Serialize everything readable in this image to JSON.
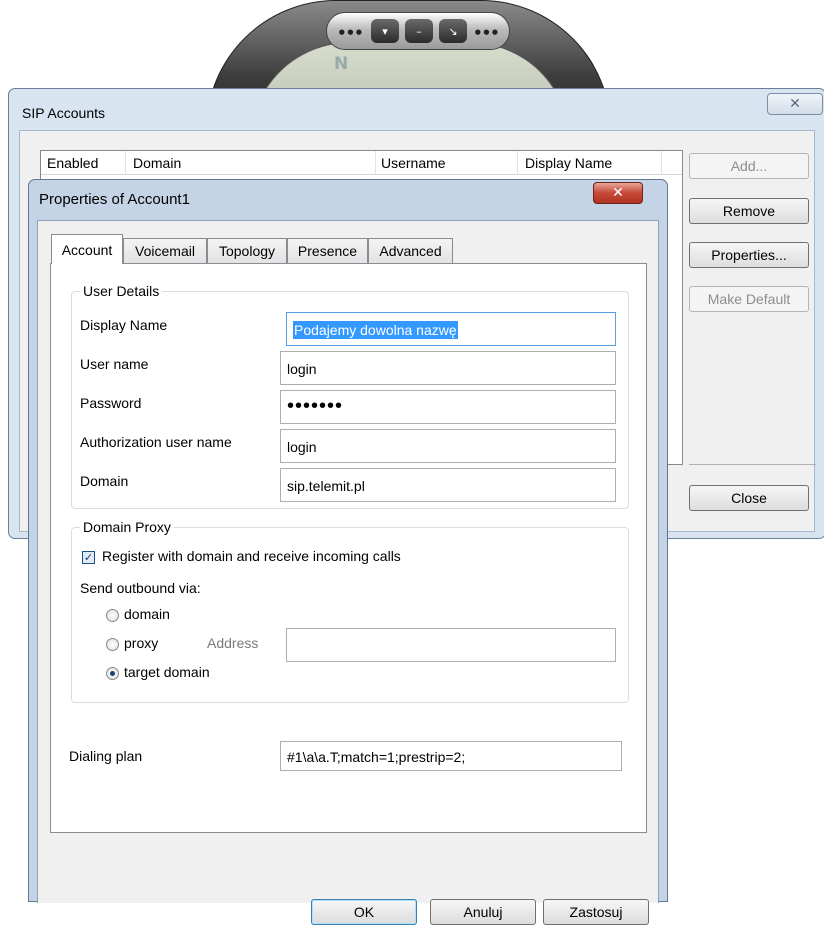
{
  "phone": {
    "buttons": [
      "▾",
      "–",
      "↘"
    ],
    "dots": "•••",
    "logo": "N"
  },
  "sip_accounts": {
    "title": "SIP Accounts",
    "close_glyph": "✕",
    "columns": [
      "Enabled",
      "Domain",
      "Username",
      "Display Name"
    ],
    "buttons": {
      "add": "Add...",
      "remove": "Remove",
      "properties": "Properties...",
      "make_default": "Make Default",
      "close": "Close"
    }
  },
  "properties": {
    "title": "Properties of Account1",
    "close_glyph": "✕",
    "tabs": [
      "Account",
      "Voicemail",
      "Topology",
      "Presence",
      "Advanced"
    ],
    "active_tab": "Account",
    "user_details": {
      "legend": "User Details",
      "display_name_label": "Display Name",
      "display_name_value": "Podajemy dowolna nazwę",
      "user_name_label": "User name",
      "user_name_value": "login",
      "password_label": "Password",
      "password_value": "•••••••",
      "auth_user_label": "Authorization user name",
      "auth_user_value": "login",
      "domain_label": "Domain",
      "domain_value": "sip.telemit.pl"
    },
    "domain_proxy": {
      "legend": "Domain Proxy",
      "register_label": "Register with domain and receive incoming calls",
      "register_checked": true,
      "send_via_label": "Send outbound via:",
      "opt_domain": "domain",
      "opt_proxy": "proxy",
      "address_label": "Address",
      "address_value": "",
      "opt_target": "target domain",
      "selected": "target domain"
    },
    "dialing_plan_label": "Dialing plan",
    "dialing_plan_value": "#1\\a\\a.T;match=1;prestrip=2;",
    "buttons": {
      "ok": "OK",
      "cancel": "Anuluj",
      "apply": "Zastosuj"
    }
  }
}
